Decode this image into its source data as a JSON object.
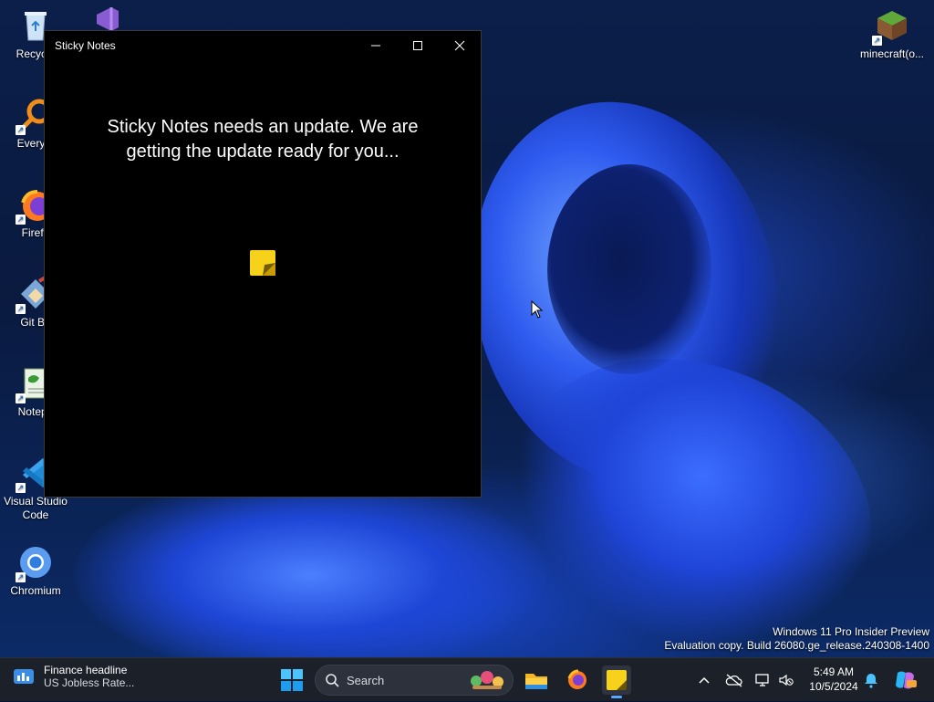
{
  "desktop": {
    "icons": [
      {
        "label": "Recycle",
        "name": "recycle-bin"
      },
      {
        "label": "Everyth",
        "name": "everything"
      },
      {
        "label": "Firefo",
        "name": "firefox"
      },
      {
        "label": "Git Ba",
        "name": "git-bash"
      },
      {
        "label": "Notepa",
        "name": "notepad"
      },
      {
        "label": "Visual Studio Code",
        "name": "vscode"
      },
      {
        "label": "Chromium",
        "name": "chromium"
      },
      {
        "label": "minecraft(o...",
        "name": "minecraft"
      }
    ]
  },
  "window": {
    "title": "Sticky Notes",
    "message": "Sticky Notes needs an update. We are getting the update ready for you..."
  },
  "watermark": {
    "line1": "Windows 11 Pro Insider Preview",
    "line2": "Evaluation copy. Build 26080.ge_release.240308-1400"
  },
  "taskbar": {
    "widget": {
      "title": "Finance headline",
      "subtitle": "US Jobless Rate..."
    },
    "search": {
      "placeholder": "Search"
    },
    "clock": {
      "time": "5:49 AM",
      "date": "10/5/2024"
    }
  },
  "colors": {
    "sticky_yellow": "#f7d21b",
    "taskbar_bg": "#1c2029",
    "accent": "#5aa7ff"
  }
}
